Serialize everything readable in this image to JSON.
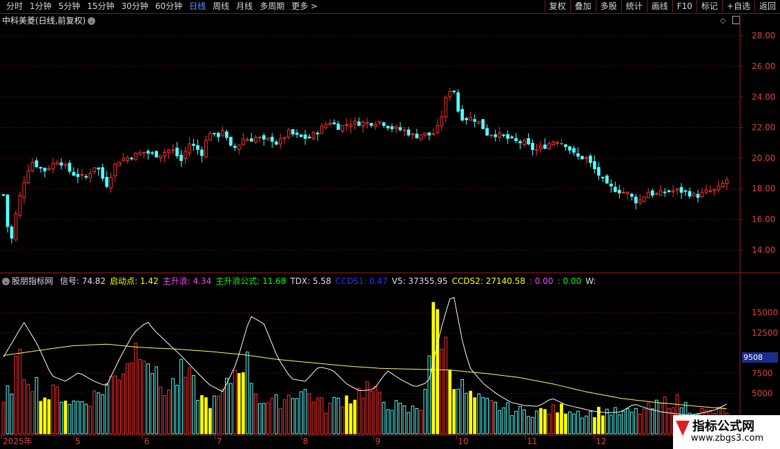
{
  "toolbar": {
    "tabs": [
      "分时",
      "1分钟",
      "5分钟",
      "15分钟",
      "30分钟",
      "60分钟",
      "日线",
      "周线",
      "月线",
      "多周期",
      "更多 >"
    ],
    "active_tab": "日线",
    "buttons": [
      "复权",
      "叠加",
      "多股",
      "统计",
      "画线",
      "F10",
      "标记",
      "+自选",
      "返回"
    ]
  },
  "stock": {
    "title": "中科美菱(日线,前复权)"
  },
  "indicator": {
    "name": "股朋指标网",
    "items": [
      {
        "text": "信号: 74.82",
        "color": "#e0e0e0"
      },
      {
        "text": "启动点: 1.42",
        "color": "#ffff00"
      },
      {
        "text": "主升浪: 4.34",
        "color": "#ff40ff"
      },
      {
        "text": "主升浪公式: 11.68",
        "color": "#00ff00"
      },
      {
        "text": "TDX: 5.58",
        "color": "#e0e0e0"
      },
      {
        "text": "CCDS1: 0.47",
        "color": "#3030ff"
      },
      {
        "text": "V5: 37355.95",
        "color": "#e0e0e0"
      },
      {
        "text": "CCDS2: 27140.58",
        "color": "#ffff00"
      },
      {
        "text": ": 0.00",
        "color": "#ff40ff"
      },
      {
        "text": ": 0.00",
        "color": "#00ff00"
      },
      {
        "text": "W:",
        "color": "#e0e0e0"
      }
    ]
  },
  "axes": {
    "price_ticks": [
      "28.00",
      "26.00",
      "24.00",
      "22.00",
      "20.00",
      "18.00",
      "16.00",
      "14.00"
    ],
    "price_values": [
      28,
      26,
      24,
      22,
      20,
      18,
      16,
      14
    ],
    "price_range": [
      13.0,
      28.8
    ],
    "volume_ticks": [
      "15000",
      "12500",
      "9508",
      "7500",
      "5000"
    ],
    "volume_values": [
      15000,
      12500,
      7500,
      5000
    ],
    "volume_marker": "9508",
    "volume_marker_value": 9508,
    "volume_range": [
      0,
      19500
    ],
    "month_labels": [
      "2025年",
      "5",
      "6",
      "7",
      "8",
      "9",
      "10",
      "11",
      "12"
    ]
  },
  "colors": {
    "up": "#ff3232",
    "down": "#54ffff",
    "grid": "#8a1010",
    "highlight": "#ffff00",
    "line_white": "#ffffff",
    "line_yellow": "#ffff60"
  },
  "watermark": {
    "line1": "指标公式网",
    "line2": "www.zbgs3.com"
  },
  "chart_data": {
    "type": "candlestick",
    "n_bars": 176,
    "anchors": [
      [
        0,
        17.6
      ],
      [
        2,
        14.2
      ],
      [
        4,
        16.8
      ],
      [
        6,
        18.5
      ],
      [
        8,
        19.8
      ],
      [
        12,
        19.2
      ],
      [
        16,
        19.9
      ],
      [
        20,
        19.0
      ],
      [
        24,
        18.7
      ],
      [
        27,
        19.6
      ],
      [
        30,
        18.2
      ],
      [
        33,
        19.8
      ],
      [
        37,
        20.1
      ],
      [
        41,
        20.4
      ],
      [
        45,
        20.2
      ],
      [
        49,
        20.6
      ],
      [
        52,
        19.8
      ],
      [
        54,
        21.0
      ],
      [
        56,
        20.7
      ],
      [
        58,
        20.3
      ],
      [
        60,
        21.8
      ],
      [
        62,
        21.3
      ],
      [
        64,
        21.9
      ],
      [
        66,
        20.7
      ],
      [
        68,
        20.7
      ],
      [
        70,
        21.3
      ],
      [
        72,
        21.2
      ],
      [
        74,
        21.4
      ],
      [
        76,
        21.1
      ],
      [
        78,
        21.3
      ],
      [
        80,
        20.9
      ],
      [
        83,
        21.7
      ],
      [
        86,
        21.4
      ],
      [
        89,
        21.3
      ],
      [
        92,
        21.8
      ],
      [
        95,
        22.4
      ],
      [
        98,
        22.0
      ],
      [
        101,
        22.3
      ],
      [
        104,
        22.3
      ],
      [
        107,
        22.3
      ],
      [
        110,
        22.4
      ],
      [
        113,
        22.0
      ],
      [
        117,
        21.8
      ],
      [
        120,
        21.4
      ],
      [
        122,
        21.6
      ],
      [
        125,
        21.5
      ],
      [
        127,
        22.1
      ],
      [
        129,
        23.8
      ],
      [
        131,
        24.9
      ],
      [
        133,
        22.7
      ],
      [
        135,
        22.6
      ],
      [
        137,
        22.6
      ],
      [
        139,
        22.3
      ],
      [
        141,
        21.6
      ],
      [
        143,
        21.6
      ],
      [
        146,
        21.4
      ],
      [
        149,
        21.1
      ],
      [
        152,
        21.0
      ],
      [
        155,
        20.5
      ],
      [
        158,
        20.8
      ],
      [
        161,
        21.2
      ],
      [
        164,
        20.9
      ],
      [
        167,
        20.1
      ],
      [
        170,
        20.0
      ],
      [
        173,
        19.1
      ],
      [
        176,
        18.2
      ],
      [
        179,
        17.9
      ],
      [
        182,
        17.7
      ],
      [
        185,
        17.1
      ],
      [
        188,
        17.8
      ],
      [
        190,
        17.6
      ],
      [
        193,
        17.8
      ],
      [
        196,
        17.9
      ],
      [
        199,
        17.8
      ],
      [
        202,
        17.5
      ],
      [
        205,
        17.8
      ],
      [
        208,
        17.9
      ],
      [
        211,
        18.6
      ]
    ],
    "volume_bars_note": "volume histogram per bar, yellow bars mark signal periods",
    "volume_anchors": [
      [
        0,
        3500
      ],
      [
        2,
        5800
      ],
      [
        4,
        8800
      ],
      [
        8,
        7200
      ],
      [
        12,
        4500
      ],
      [
        16,
        5200
      ],
      [
        20,
        3800
      ],
      [
        24,
        4100
      ],
      [
        27,
        4800
      ],
      [
        30,
        6000
      ],
      [
        33,
        7200
      ],
      [
        37,
        9800
      ],
      [
        41,
        11800
      ],
      [
        45,
        6200
      ],
      [
        48,
        5400
      ],
      [
        52,
        7500
      ],
      [
        55,
        6300
      ],
      [
        58,
        4200
      ],
      [
        62,
        3900
      ],
      [
        65,
        5600
      ],
      [
        68,
        8200
      ],
      [
        70,
        9500
      ],
      [
        72,
        7800
      ],
      [
        74,
        4600
      ],
      [
        78,
        3600
      ],
      [
        82,
        4400
      ],
      [
        86,
        5400
      ],
      [
        90,
        4800
      ],
      [
        94,
        3200
      ],
      [
        98,
        4300
      ],
      [
        102,
        4600
      ],
      [
        106,
        5800
      ],
      [
        110,
        4200
      ],
      [
        114,
        3500
      ],
      [
        118,
        2800
      ],
      [
        122,
        3400
      ],
      [
        126,
        15500
      ],
      [
        128,
        12500
      ],
      [
        130,
        8800
      ],
      [
        132,
        6600
      ],
      [
        136,
        4600
      ],
      [
        140,
        3800
      ],
      [
        146,
        3200
      ],
      [
        150,
        2800
      ],
      [
        155,
        2700
      ],
      [
        160,
        2900
      ],
      [
        165,
        3200
      ],
      [
        170,
        2400
      ],
      [
        175,
        2900
      ],
      [
        180,
        2500
      ],
      [
        185,
        2700
      ],
      [
        190,
        3300
      ],
      [
        195,
        4300
      ],
      [
        200,
        3200
      ],
      [
        205,
        2600
      ],
      [
        211,
        2900
      ]
    ],
    "white_line_anchors": [
      [
        0,
        9500
      ],
      [
        6,
        13800
      ],
      [
        10,
        11000
      ],
      [
        14,
        7200
      ],
      [
        18,
        6500
      ],
      [
        22,
        7600
      ],
      [
        26,
        6600
      ],
      [
        30,
        5900
      ],
      [
        34,
        9400
      ],
      [
        38,
        12500
      ],
      [
        42,
        13900
      ],
      [
        44,
        12800
      ],
      [
        46,
        12000
      ],
      [
        48,
        11200
      ],
      [
        52,
        9600
      ],
      [
        56,
        7800
      ],
      [
        60,
        6100
      ],
      [
        64,
        5200
      ],
      [
        68,
        8800
      ],
      [
        72,
        14600
      ],
      [
        76,
        13600
      ],
      [
        80,
        9400
      ],
      [
        84,
        6800
      ],
      [
        88,
        6500
      ],
      [
        92,
        8300
      ],
      [
        96,
        7900
      ],
      [
        100,
        6200
      ],
      [
        104,
        5300
      ],
      [
        108,
        5500
      ],
      [
        112,
        7800
      ],
      [
        116,
        6700
      ],
      [
        120,
        5800
      ],
      [
        124,
        6400
      ],
      [
        128,
        13600
      ],
      [
        131,
        17800
      ],
      [
        134,
        11200
      ],
      [
        136,
        8200
      ],
      [
        140,
        6200
      ],
      [
        144,
        4900
      ],
      [
        148,
        3900
      ],
      [
        152,
        3500
      ],
      [
        156,
        3400
      ],
      [
        160,
        4400
      ],
      [
        164,
        3600
      ],
      [
        168,
        3200
      ],
      [
        172,
        2800
      ],
      [
        176,
        2600
      ],
      [
        180,
        2700
      ],
      [
        184,
        3700
      ],
      [
        188,
        3100
      ],
      [
        192,
        2700
      ],
      [
        196,
        2500
      ],
      [
        200,
        2300
      ],
      [
        204,
        2600
      ],
      [
        208,
        3000
      ],
      [
        211,
        3700
      ]
    ],
    "yellow_line_anchors": [
      [
        0,
        9700
      ],
      [
        10,
        10300
      ],
      [
        20,
        10900
      ],
      [
        30,
        11100
      ],
      [
        40,
        10700
      ],
      [
        50,
        10500
      ],
      [
        60,
        10200
      ],
      [
        70,
        9800
      ],
      [
        80,
        9200
      ],
      [
        90,
        8800
      ],
      [
        100,
        8400
      ],
      [
        110,
        8100
      ],
      [
        120,
        8000
      ],
      [
        130,
        7900
      ],
      [
        140,
        7500
      ],
      [
        150,
        7000
      ],
      [
        160,
        6200
      ],
      [
        170,
        5200
      ],
      [
        180,
        4400
      ],
      [
        190,
        3900
      ],
      [
        200,
        3500
      ],
      [
        211,
        3100
      ]
    ]
  }
}
